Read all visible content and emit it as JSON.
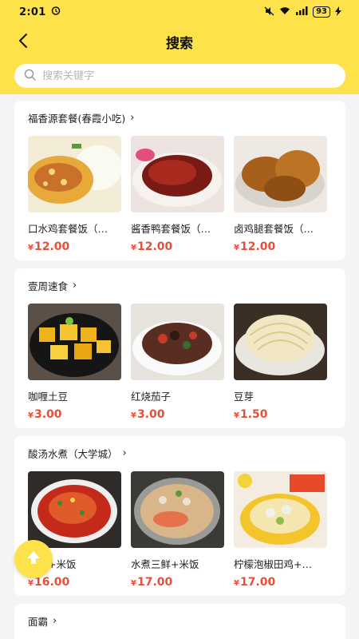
{
  "status": {
    "time": "2:01",
    "battery": "93"
  },
  "nav": {
    "title": "搜索"
  },
  "search": {
    "placeholder": "搜索关键字"
  },
  "shops": [
    {
      "name": "福香源套餐(春霞小吃)",
      "dishes": [
        {
          "name": "口水鸡套餐饭（…",
          "yen": "¥",
          "price": "12.00"
        },
        {
          "name": "酱香鸭套餐饭（…",
          "yen": "¥",
          "price": "12.00"
        },
        {
          "name": "卤鸡腿套餐饭（…",
          "yen": "¥",
          "price": "12.00"
        }
      ]
    },
    {
      "name": "壹周速食",
      "dishes": [
        {
          "name": "咖喱土豆",
          "yen": "¥",
          "price": "3.00"
        },
        {
          "name": "红烧茄子",
          "yen": "¥",
          "price": "3.00"
        },
        {
          "name": "豆芽",
          "yen": "¥",
          "price": "1.50"
        }
      ]
    },
    {
      "name": "酸汤水煮（大学城）",
      "dishes": [
        {
          "name": "田鸡+米饭",
          "yen": "¥",
          "price": "16.00"
        },
        {
          "name": "水煮三鲜+米饭",
          "yen": "¥",
          "price": "17.00"
        },
        {
          "name": "柠檬泡椒田鸡+…",
          "yen": "¥",
          "price": "17.00"
        }
      ]
    },
    {
      "name": "面霸",
      "dishes": []
    }
  ],
  "colors": {
    "accent": "#fde24a",
    "price": "#e4503a"
  }
}
